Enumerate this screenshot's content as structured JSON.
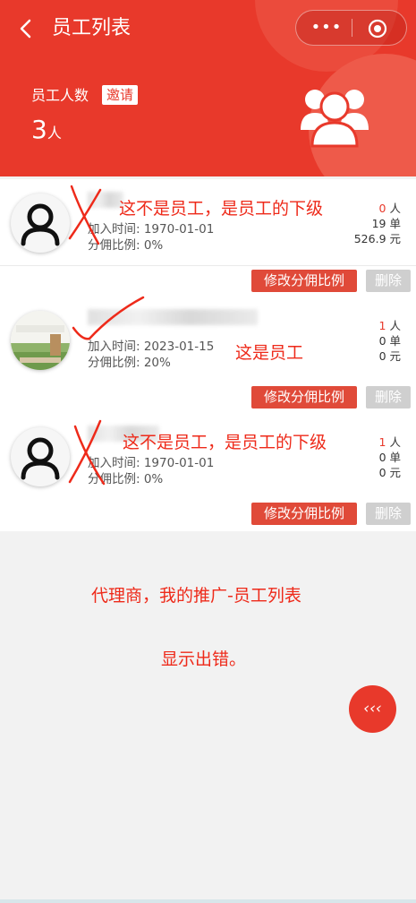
{
  "header": {
    "title": "员工列表",
    "employee_count_label": "员工人数",
    "invite_label": "邀请",
    "count_value": "3",
    "count_unit": "人",
    "capsule_menu": "•••"
  },
  "employees": [
    {
      "join_time": "加入时间: 1970-01-01",
      "commission": "分佣比例: 0%",
      "people": "0",
      "people_unit": "人",
      "orders": "19 单",
      "amount": "526.9 元",
      "annotation": "这不是员工，是员工的下级"
    },
    {
      "join_time": "加入时间: 2023-01-15",
      "commission": "分佣比例: 20%",
      "people": "1",
      "people_unit": "人",
      "orders": "0 单",
      "amount": "0 元",
      "annotation": "这是员工"
    },
    {
      "join_time": "加入时间: 1970-01-01",
      "commission": "分佣比例: 0%",
      "people": "1",
      "people_unit": "人",
      "orders": "0 单",
      "amount": "0 元",
      "annotation": "这不是员工，是员工的下级"
    }
  ],
  "actions": {
    "edit_label": "修改分佣比例",
    "delete_label": "删除"
  },
  "notes": {
    "line1": "代理商，我的推广-员工列表",
    "line2": "显示出错。"
  },
  "fab_label": "‹‹‹",
  "colors": {
    "primary": "#e8392b",
    "annotation": "#ee2a1a",
    "disabled": "#cfcfcf"
  }
}
